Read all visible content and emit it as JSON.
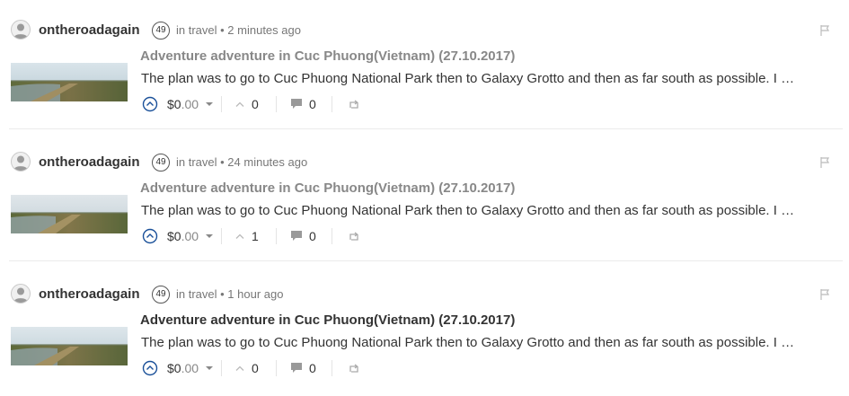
{
  "colors": {
    "upvote_accent": "#1a5099",
    "muted": "#888888"
  },
  "posts": [
    {
      "author": "ontheroadagain",
      "reputation": "49",
      "meta": "in travel • 2 minutes ago",
      "title": "Adventure adventure in Cuc Phuong(Vietnam) (27.10.2017)",
      "body": "The plan was to go to Cuc Phuong National Park then to Galaxy Grotto and then as far south as possible. I …",
      "payout": "$0",
      "payout_cents": ".00",
      "votes": "0",
      "comments": "0"
    },
    {
      "author": "ontheroadagain",
      "reputation": "49",
      "meta": "in travel • 24 minutes ago",
      "title": "Adventure adventure in Cuc Phuong(Vietnam) (27.10.2017)",
      "body": "The plan was to go to Cuc Phuong National Park then to Galaxy Grotto and then as far south as possible. I …",
      "payout": "$0",
      "payout_cents": ".00",
      "votes": "1",
      "comments": "0"
    },
    {
      "author": "ontheroadagain",
      "reputation": "49",
      "meta": "in travel • 1 hour ago",
      "title": "Adventure adventure in Cuc Phuong(Vietnam) (27.10.2017)",
      "body": "The plan was to go to Cuc Phuong National Park then to Galaxy Grotto and then as far south as possible. I …",
      "payout": "$0",
      "payout_cents": ".00",
      "votes": "0",
      "comments": "0"
    }
  ]
}
